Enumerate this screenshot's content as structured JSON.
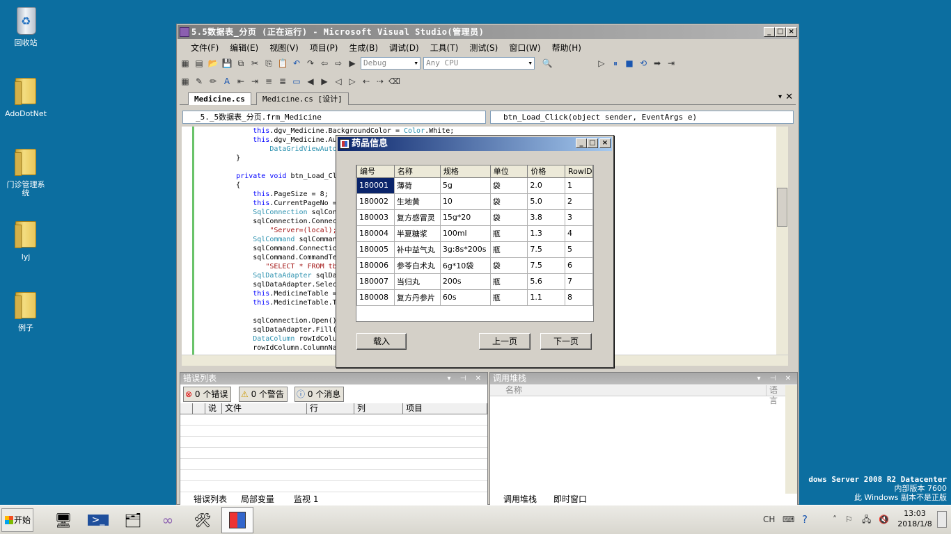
{
  "desktop": {
    "icons": [
      {
        "label": "回收站"
      },
      {
        "label": "AdoDotNet"
      },
      {
        "label": "门诊管理系统"
      },
      {
        "label": "lyj"
      },
      {
        "label": "例子"
      }
    ],
    "watermark": {
      "line1": "dows Server 2008 R2 Datacenter",
      "line2": "内部版本 7600",
      "line3": "此 Windows 副本不是正版"
    }
  },
  "vs": {
    "title": "5.5数据表_分页 (正在运行) - Microsoft Visual Studio(管理员)",
    "menu": [
      "文件(F)",
      "编辑(E)",
      "视图(V)",
      "项目(P)",
      "生成(B)",
      "调试(D)",
      "工具(T)",
      "测试(S)",
      "窗口(W)",
      "帮助(H)"
    ],
    "toolbar": {
      "config": "Debug",
      "platform": "Any CPU"
    },
    "tabs": [
      "Medicine.cs",
      "Medicine.cs [设计]"
    ],
    "nav": {
      "left": "_5._5数据表_分页.frm_Medicine",
      "right": "btn_Load_Click(object sender, EventArgs e)"
    },
    "code": [
      "            this.dgv_Medicine.BackgroundColor = Color.White;",
      "            this.dgv_Medicine.Aut",
      "                DataGridViewAutoS",
      "        }",
      "",
      "        private void btn_Load_Cli",
      "        {",
      "            this.PageSize = 8;",
      "            this.CurrentPageNo = ",
      "            SqlConnection sqlConn",
      "            sqlConnection.Connect",
      "                \"Server=(local);D",
      "            SqlCommand sqlCommand",
      "            sqlCommand.Connection",
      "            sqlCommand.CommandTex",
      "               \"SELECT * FROM tb_",
      "            SqlDataAdapter sqlDat",
      "            sqlDataAdapter.Select",
      "            this.MedicineTable = ",
      "            this.MedicineTable.Ta",
      "",
      "            sqlConnection.Open();",
      "            sqlDataAdapter.Fill(t",
      "            DataColumn rowIdColum",
      "            rowIdColumn.ColumnNam"
    ],
    "error_pane": {
      "title": "错误列表",
      "errors": "0 个错误",
      "warnings": "0 个警告",
      "messages": "0 个消息",
      "columns": [
        "说",
        "文件",
        "行",
        "列",
        "项目"
      ],
      "bottom_tabs": [
        "错误列表",
        "局部变量",
        "监视 1"
      ]
    },
    "stack_pane": {
      "title": "调用堆栈",
      "columns": [
        "名称",
        "语言"
      ],
      "bottom_tabs": [
        "调用堆栈",
        "即时窗口"
      ]
    }
  },
  "dialog": {
    "title": "药品信息",
    "columns": [
      "编号",
      "名称",
      "规格",
      "单位",
      "价格",
      "RowID"
    ],
    "rows": [
      [
        "180001",
        "薄荷",
        "5g",
        "袋",
        "2.0",
        "1"
      ],
      [
        "180002",
        "生地黄",
        "10",
        "袋",
        "5.0",
        "2"
      ],
      [
        "180003",
        "复方感冒灵",
        "15g*20",
        "袋",
        "3.8",
        "3"
      ],
      [
        "180004",
        "半夏糖浆",
        "100ml",
        "瓶",
        "1.3",
        "4"
      ],
      [
        "180005",
        "补中益气丸",
        "3g:8s*200s",
        "瓶",
        "7.5",
        "5"
      ],
      [
        "180006",
        "参苓白术丸",
        "6g*10袋",
        "袋",
        "7.5",
        "6"
      ],
      [
        "180007",
        "当归丸",
        "200s",
        "瓶",
        "5.6",
        "7"
      ],
      [
        "180008",
        "复方丹参片",
        "60s",
        "瓶",
        "1.1",
        "8"
      ]
    ],
    "load_button": "载入",
    "prev_button": "上一页",
    "next_button": "下一页"
  },
  "taskbar": {
    "start": "开始",
    "lang": "CH",
    "time": "13:03",
    "date": "2018/1/8"
  }
}
